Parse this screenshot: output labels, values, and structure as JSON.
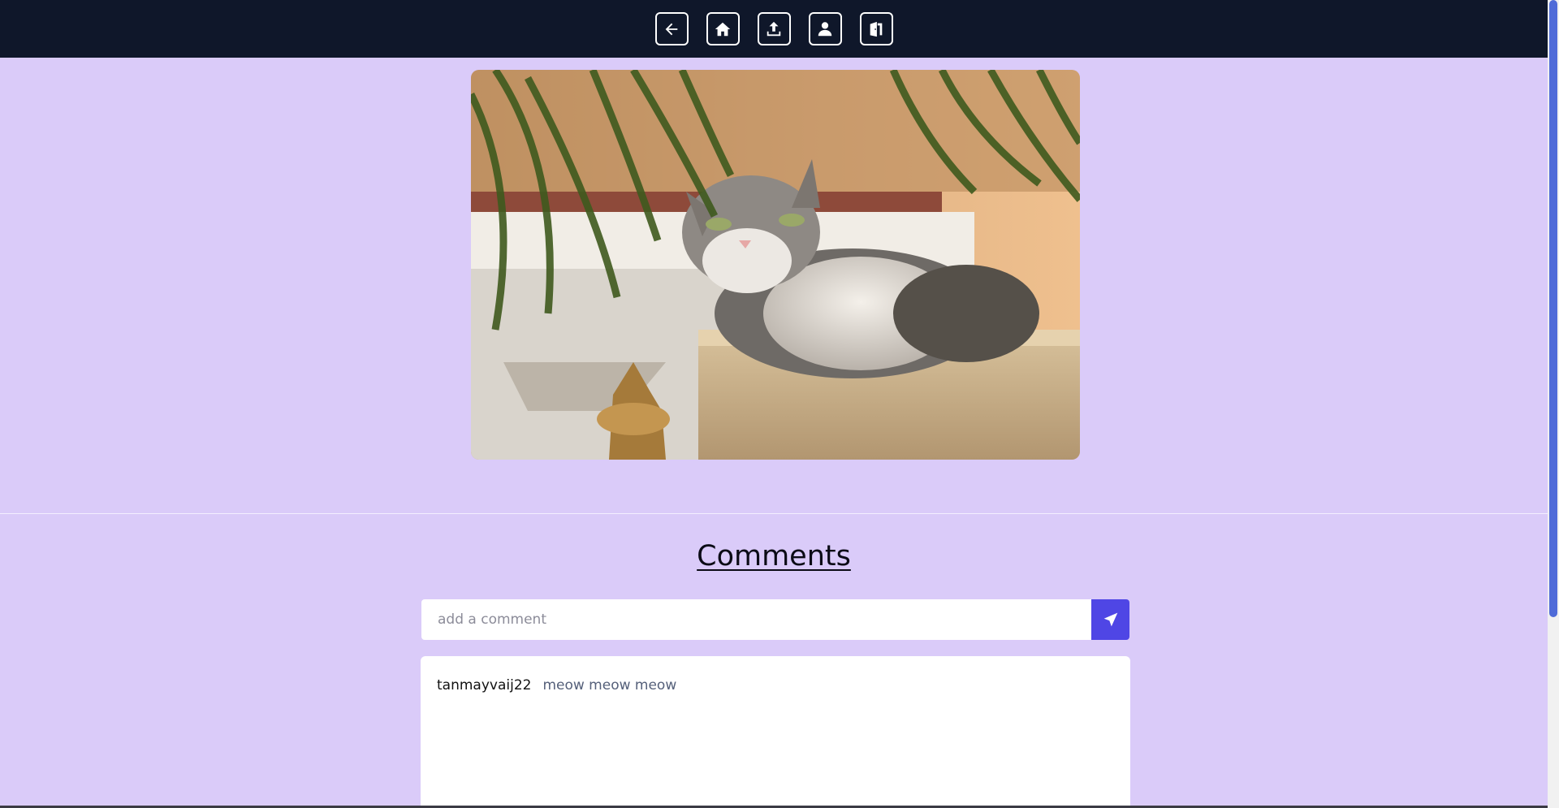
{
  "nav": {
    "buttons": [
      {
        "icon": "back-arrow-icon"
      },
      {
        "icon": "home-icon"
      },
      {
        "icon": "upload-icon"
      },
      {
        "icon": "user-icon"
      },
      {
        "icon": "logout-door-icon"
      }
    ]
  },
  "post": {
    "image_icon": "cat-photo"
  },
  "comments": {
    "title": "Comments",
    "input_placeholder": "add a comment",
    "send_icon": "send-icon",
    "items": [
      {
        "user": "tanmayvaij22",
        "text": "meow meow meow"
      }
    ]
  },
  "colors": {
    "navbar": "#0f172a",
    "page_bg": "#dacbf9",
    "accent": "#4f46e5"
  }
}
